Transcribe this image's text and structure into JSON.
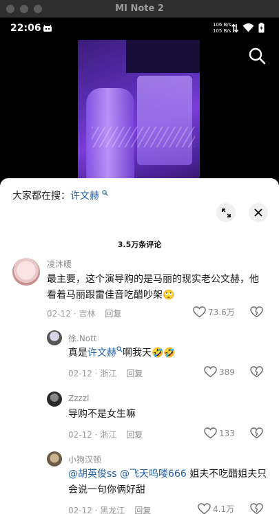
{
  "window": {
    "title": "MI Note 2"
  },
  "status": {
    "time": "22:06",
    "speed_up": "106 B/s",
    "speed_down": "105 B/s"
  },
  "sheet": {
    "search_prefix": "大家都在搜：",
    "search_keyword": "许文赫",
    "comment_count": "3.5万条评论"
  },
  "comments": [
    {
      "user": "凌沐暖",
      "text": "最主要，这个演导购的是马丽的现实老公文赫，他看着马丽跟雷佳音吃醋吵架🙄",
      "date": "02-12 · 吉林",
      "reply": "回复",
      "likes": "73.6万"
    },
    {
      "user": "徐.Nott",
      "text_before": "真是",
      "text_link": "许文赫",
      "text_after": "啊我天🤣🤣",
      "date": "02-12 · 浙江",
      "reply": "回复",
      "likes": "389"
    },
    {
      "user": "Zzzzl",
      "text": "导购不是女生嘛",
      "date": "02-12 · 浙江",
      "reply": "回复",
      "likes": "133"
    },
    {
      "user": "小狗汉顿",
      "mention1": "@胡英俊ss",
      "mention2": "@飞天呜喽666",
      "text_after": " 姐夫不吃醋姐夫只会说一句你俩好甜",
      "date": "02-12 · 黑龙江",
      "reply": "回复",
      "likes": "4.1万"
    }
  ],
  "colors": {
    "link": "#1f5fa8",
    "video_accent": "#7a3cd9"
  }
}
